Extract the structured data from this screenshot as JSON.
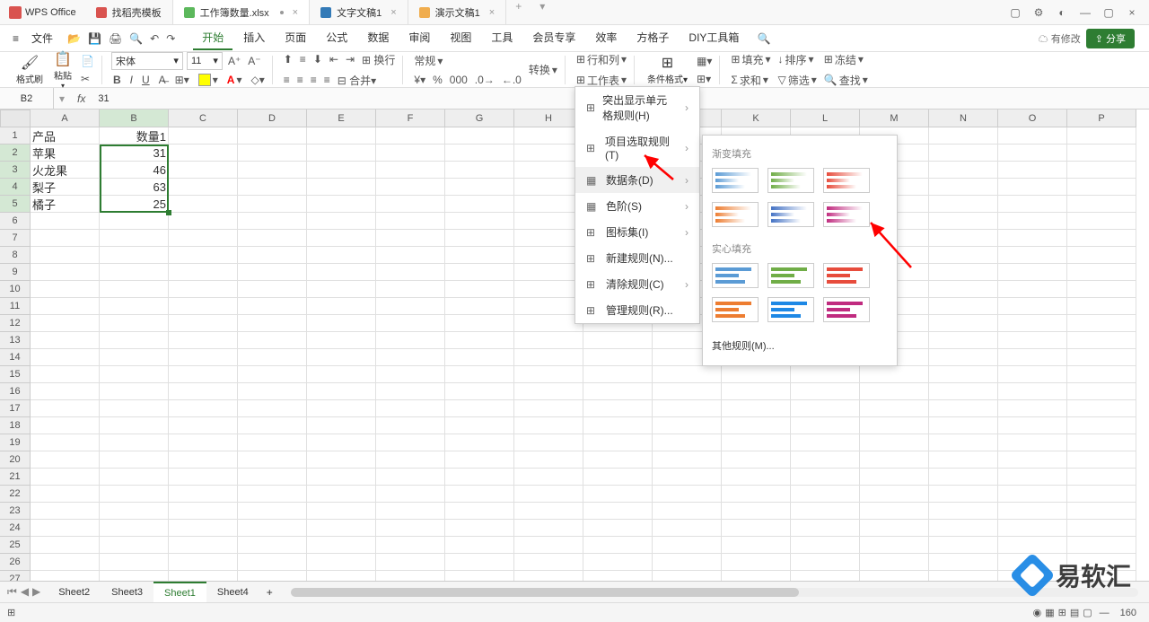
{
  "app": {
    "name": "WPS Office"
  },
  "fileTabs": [
    {
      "label": "找稻壳模板",
      "icon": "d"
    },
    {
      "label": "工作簿数量.xlsx",
      "icon": "s",
      "active": true,
      "dirty": true
    },
    {
      "label": "文字文稿1",
      "icon": "w"
    },
    {
      "label": "演示文稿1",
      "icon": "p"
    }
  ],
  "menubar": {
    "file": "文件",
    "changes": "有修改",
    "share": "分享"
  },
  "menus": [
    "开始",
    "插入",
    "页面",
    "公式",
    "数据",
    "审阅",
    "视图",
    "工具",
    "会员专享",
    "效率",
    "方格子",
    "DIY工具箱"
  ],
  "activeMenu": "开始",
  "ribbon": {
    "formatBrush": "格式刷",
    "paste": "粘贴",
    "font": "宋体",
    "size": "11",
    "normal": "常规",
    "convert": "转换",
    "rowCol": "行和列",
    "worksheet": "工作表",
    "condFmt": "条件格式",
    "fill": "填充",
    "sort": "排序",
    "freeze": "冻结",
    "sum": "求和",
    "filter": "筛选",
    "find": "查找"
  },
  "nameBox": "B2",
  "formula": "31",
  "columns": [
    "A",
    "B",
    "C",
    "D",
    "E",
    "F",
    "G",
    "H",
    "I",
    "J",
    "K",
    "L",
    "M",
    "N",
    "O",
    "P"
  ],
  "rows": [
    1,
    2,
    3,
    4,
    5,
    6,
    7,
    8,
    9,
    10,
    11,
    12,
    13,
    14,
    15,
    16,
    17,
    18,
    19,
    20,
    21,
    22,
    23,
    24,
    25,
    26,
    27
  ],
  "data": {
    "A1": "产品",
    "B1": "数量1",
    "A2": "苹果",
    "B2": "31",
    "A3": "火龙果",
    "B3": "46",
    "A4": "梨子",
    "B4": "63",
    "A5": "橘子",
    "B5": "25"
  },
  "cfMenu": {
    "highlight": "突出显示单元格规则(H)",
    "topBottom": "项目选取规则(T)",
    "dataBars": "数据条(D)",
    "colorScales": "色阶(S)",
    "iconSets": "图标集(I)",
    "newRule": "新建规则(N)...",
    "clearRules": "清除规则(C)",
    "manageRules": "管理规则(R)..."
  },
  "dbSub": {
    "grad": "渐变填充",
    "solid": "实心填充",
    "more": "其他规则(M)..."
  },
  "sheetTabs": [
    "Sheet2",
    "Sheet3",
    "Sheet1",
    "Sheet4"
  ],
  "activeSheet": "Sheet1",
  "status": {
    "zoom": "160"
  },
  "watermark": "易软汇"
}
